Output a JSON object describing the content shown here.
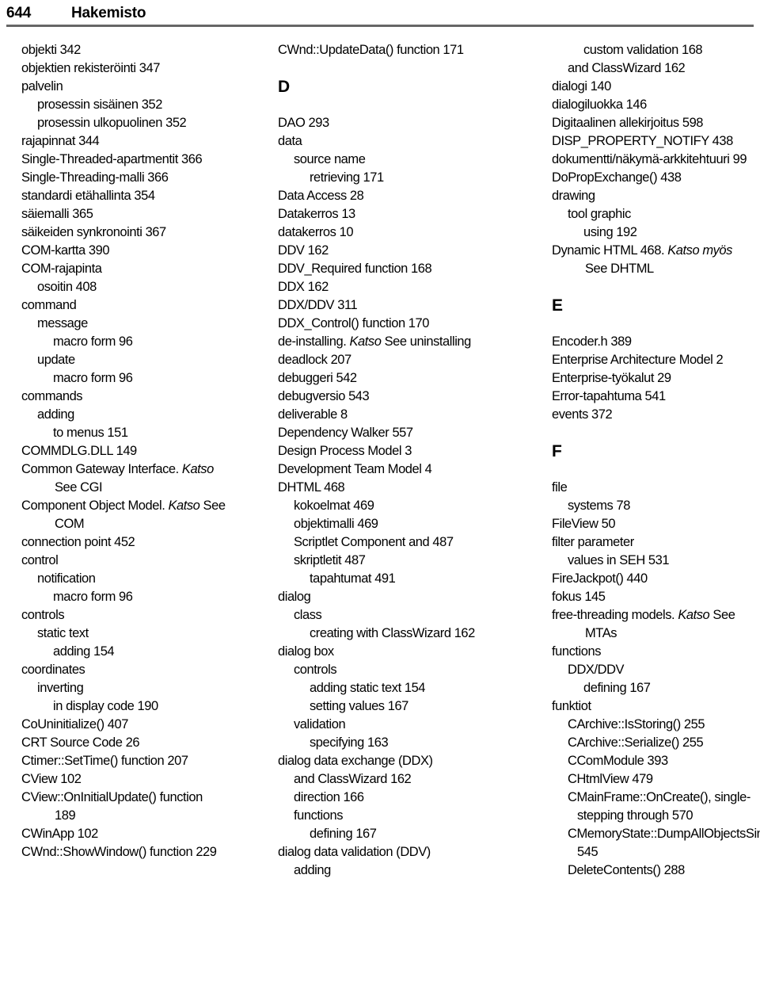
{
  "running_head": {
    "folio": "644",
    "title": "Hakemisto",
    "rule_color": "#666666"
  },
  "columns": [
    {
      "name": "column-1",
      "blocks": [
        {
          "kind": "entry",
          "level": 0,
          "text": "objekti 342"
        },
        {
          "kind": "entry",
          "level": 0,
          "text": "objektien rekisteröinti 347"
        },
        {
          "kind": "entry",
          "level": 0,
          "text": "palvelin"
        },
        {
          "kind": "entry",
          "level": 1,
          "text": "prosessin sisäinen 352"
        },
        {
          "kind": "entry",
          "level": 1,
          "text": "prosessin ulkopuolinen 352"
        },
        {
          "kind": "entry",
          "level": 0,
          "text": "rajapinnat 344"
        },
        {
          "kind": "entry",
          "level": 0,
          "text": "Single-Threaded-apartmentit 366"
        },
        {
          "kind": "entry",
          "level": 0,
          "text": "Single-Threading-malli 366"
        },
        {
          "kind": "entry",
          "level": 0,
          "text": "standardi etähallinta 354"
        },
        {
          "kind": "entry",
          "level": 0,
          "text": "säiemalli 365"
        },
        {
          "kind": "entry",
          "level": 0,
          "text": "säikeiden synkronointi 367"
        },
        {
          "kind": "entry",
          "level": 0,
          "text": "COM-kartta 390"
        },
        {
          "kind": "entry",
          "level": 0,
          "text": "COM-rajapinta"
        },
        {
          "kind": "entry",
          "level": 1,
          "text": "osoitin 408"
        },
        {
          "kind": "entry",
          "level": 0,
          "text": "command"
        },
        {
          "kind": "entry",
          "level": 1,
          "text": "message"
        },
        {
          "kind": "entry",
          "level": 2,
          "text": "macro form 96"
        },
        {
          "kind": "entry",
          "level": 1,
          "text": "update"
        },
        {
          "kind": "entry",
          "level": 2,
          "text": "macro form 96"
        },
        {
          "kind": "entry",
          "level": 0,
          "text": "commands"
        },
        {
          "kind": "entry",
          "level": 1,
          "text": "adding"
        },
        {
          "kind": "entry",
          "level": 2,
          "text": "to menus 151"
        },
        {
          "kind": "entry",
          "level": 0,
          "text": "COMMDLG.DLL 149"
        },
        {
          "kind": "entry-italic",
          "level": 0,
          "pre": "Common Gateway Interface. ",
          "italic": "Katso",
          "post": ""
        },
        {
          "kind": "entry",
          "level": 0,
          "continuation": true,
          "text": "See CGI"
        },
        {
          "kind": "entry-italic",
          "level": 0,
          "pre": "Component Object Model. ",
          "italic": "Katso",
          "post": " See"
        },
        {
          "kind": "entry",
          "level": 0,
          "continuation": true,
          "text": "COM"
        },
        {
          "kind": "entry",
          "level": 0,
          "text": "connection point 452"
        },
        {
          "kind": "entry",
          "level": 0,
          "text": "control"
        },
        {
          "kind": "entry",
          "level": 1,
          "text": "notification"
        },
        {
          "kind": "entry",
          "level": 2,
          "text": "macro form 96"
        },
        {
          "kind": "entry",
          "level": 0,
          "text": "controls"
        },
        {
          "kind": "entry",
          "level": 1,
          "text": "static text"
        },
        {
          "kind": "entry",
          "level": 2,
          "text": "adding 154"
        },
        {
          "kind": "entry",
          "level": 0,
          "text": "coordinates"
        },
        {
          "kind": "entry",
          "level": 1,
          "text": "inverting"
        },
        {
          "kind": "entry",
          "level": 2,
          "text": "in display code 190"
        },
        {
          "kind": "entry",
          "level": 0,
          "text": "CoUninitialize() 407"
        },
        {
          "kind": "entry",
          "level": 0,
          "text": "CRT Source Code 26"
        },
        {
          "kind": "entry",
          "level": 0,
          "text": "Ctimer::SetTime() function 207"
        },
        {
          "kind": "entry",
          "level": 0,
          "text": "CView 102"
        },
        {
          "kind": "entry",
          "level": 0,
          "text": "CView::OnInitialUpdate() function"
        },
        {
          "kind": "entry",
          "level": 0,
          "continuation": true,
          "text": "189"
        },
        {
          "kind": "entry",
          "level": 0,
          "text": "CWinApp 102"
        },
        {
          "kind": "entry",
          "level": 0,
          "text": "CWnd::ShowWindow() function 229"
        }
      ]
    },
    {
      "name": "column-2",
      "blocks": [
        {
          "kind": "entry",
          "level": 0,
          "text": "CWnd::UpdateData() function 171"
        },
        {
          "kind": "spacer"
        },
        {
          "kind": "letter",
          "text": "D"
        },
        {
          "kind": "spacer"
        },
        {
          "kind": "entry",
          "level": 0,
          "text": "DAO 293"
        },
        {
          "kind": "entry",
          "level": 0,
          "text": "data"
        },
        {
          "kind": "entry",
          "level": 1,
          "text": "source name"
        },
        {
          "kind": "entry",
          "level": 2,
          "text": "retrieving 171"
        },
        {
          "kind": "entry",
          "level": 0,
          "text": "Data Access 28"
        },
        {
          "kind": "entry",
          "level": 0,
          "text": "Datakerros 13"
        },
        {
          "kind": "entry",
          "level": 0,
          "text": "datakerros 10"
        },
        {
          "kind": "entry",
          "level": 0,
          "text": "DDV 162"
        },
        {
          "kind": "entry",
          "level": 0,
          "text": "DDV_Required function 168"
        },
        {
          "kind": "entry",
          "level": 0,
          "text": "DDX 162"
        },
        {
          "kind": "entry",
          "level": 0,
          "text": "DDX/DDV 311"
        },
        {
          "kind": "entry",
          "level": 0,
          "text": "DDX_Control() function 170"
        },
        {
          "kind": "entry-italic",
          "level": 0,
          "pre": "de-installing. ",
          "italic": "Katso",
          "post": " See uninstalling"
        },
        {
          "kind": "entry",
          "level": 0,
          "text": "deadlock 207"
        },
        {
          "kind": "entry",
          "level": 0,
          "text": "debuggeri 542"
        },
        {
          "kind": "entry",
          "level": 0,
          "text": "debugversio 543"
        },
        {
          "kind": "entry",
          "level": 0,
          "text": "deliverable 8"
        },
        {
          "kind": "entry",
          "level": 0,
          "text": "Dependency Walker 557"
        },
        {
          "kind": "entry",
          "level": 0,
          "text": "Design Process Model 3"
        },
        {
          "kind": "entry",
          "level": 0,
          "text": "Development Team Model 4"
        },
        {
          "kind": "entry",
          "level": 0,
          "text": "DHTML 468"
        },
        {
          "kind": "entry",
          "level": 1,
          "text": "kokoelmat 469"
        },
        {
          "kind": "entry",
          "level": 1,
          "text": "objektimalli 469"
        },
        {
          "kind": "entry",
          "level": 1,
          "text": "Scriptlet Component and 487"
        },
        {
          "kind": "entry",
          "level": 1,
          "text": "skriptletit 487"
        },
        {
          "kind": "entry",
          "level": 2,
          "text": "tapahtumat 491"
        },
        {
          "kind": "entry",
          "level": 0,
          "text": "dialog"
        },
        {
          "kind": "entry",
          "level": 1,
          "text": "class"
        },
        {
          "kind": "entry",
          "level": 2,
          "text": "creating with ClassWizard 162"
        },
        {
          "kind": "entry",
          "level": 0,
          "text": "dialog box"
        },
        {
          "kind": "entry",
          "level": 1,
          "text": "controls"
        },
        {
          "kind": "entry",
          "level": 2,
          "text": "adding static text 154"
        },
        {
          "kind": "entry",
          "level": 2,
          "text": "setting values 167"
        },
        {
          "kind": "entry",
          "level": 1,
          "text": "validation"
        },
        {
          "kind": "entry",
          "level": 2,
          "text": "specifying 163"
        },
        {
          "kind": "entry",
          "level": 0,
          "text": "dialog data exchange (DDX)"
        },
        {
          "kind": "entry",
          "level": 1,
          "text": "and ClassWizard 162"
        },
        {
          "kind": "entry",
          "level": 1,
          "text": "direction 166"
        },
        {
          "kind": "entry",
          "level": 1,
          "text": "functions"
        },
        {
          "kind": "entry",
          "level": 2,
          "text": "defining 167"
        },
        {
          "kind": "entry",
          "level": 0,
          "text": "dialog data validation (DDV)"
        },
        {
          "kind": "entry",
          "level": 1,
          "text": "adding"
        }
      ]
    },
    {
      "name": "column-3",
      "blocks": [
        {
          "kind": "entry",
          "level": 2,
          "text": "custom validation 168"
        },
        {
          "kind": "entry",
          "level": 1,
          "text": "and ClassWizard 162"
        },
        {
          "kind": "entry",
          "level": 0,
          "text": "dialogi 140"
        },
        {
          "kind": "entry",
          "level": 0,
          "text": "dialogiluokka 146"
        },
        {
          "kind": "entry",
          "level": 0,
          "text": "Digitaalinen allekirjoitus 598"
        },
        {
          "kind": "entry",
          "level": 0,
          "text": "DISP_PROPERTY_NOTIFY 438"
        },
        {
          "kind": "entry",
          "level": 0,
          "text": "dokumentti/näkymä-arkkitehtuuri 99"
        },
        {
          "kind": "entry",
          "level": 0,
          "text": "DoPropExchange() 438"
        },
        {
          "kind": "entry",
          "level": 0,
          "text": "drawing"
        },
        {
          "kind": "entry",
          "level": 1,
          "text": "tool graphic"
        },
        {
          "kind": "entry",
          "level": 2,
          "text": "using 192"
        },
        {
          "kind": "entry-italic",
          "level": 0,
          "pre": "Dynamic HTML 468. ",
          "italic": "Katso myös",
          "post": ""
        },
        {
          "kind": "entry",
          "level": 0,
          "continuation": true,
          "text": "See DHTML"
        },
        {
          "kind": "spacer"
        },
        {
          "kind": "letter",
          "text": "E"
        },
        {
          "kind": "spacer"
        },
        {
          "kind": "entry",
          "level": 0,
          "text": "Encoder.h 389"
        },
        {
          "kind": "entry",
          "level": 0,
          "text": "Enterprise Architecture Model 2"
        },
        {
          "kind": "entry",
          "level": 0,
          "text": "Enterprise-työkalut 29"
        },
        {
          "kind": "entry",
          "level": 0,
          "text": "Error-tapahtuma 541"
        },
        {
          "kind": "entry",
          "level": 0,
          "text": "events 372"
        },
        {
          "kind": "spacer"
        },
        {
          "kind": "letter",
          "text": "F"
        },
        {
          "kind": "spacer"
        },
        {
          "kind": "entry",
          "level": 0,
          "text": "file"
        },
        {
          "kind": "entry",
          "level": 1,
          "text": "systems 78"
        },
        {
          "kind": "entry",
          "level": 0,
          "text": "FileView 50"
        },
        {
          "kind": "entry",
          "level": 0,
          "text": "filter parameter"
        },
        {
          "kind": "entry",
          "level": 1,
          "text": "values in SEH 531"
        },
        {
          "kind": "entry",
          "level": 0,
          "text": "FireJackpot() 440"
        },
        {
          "kind": "entry",
          "level": 0,
          "text": "fokus 145"
        },
        {
          "kind": "entry-italic",
          "level": 0,
          "pre": "free-threading models. ",
          "italic": "Katso",
          "post": " See"
        },
        {
          "kind": "entry",
          "level": 0,
          "continuation": true,
          "text": "MTAs"
        },
        {
          "kind": "entry",
          "level": 0,
          "text": "functions"
        },
        {
          "kind": "entry",
          "level": 1,
          "text": "DDX/DDV"
        },
        {
          "kind": "entry",
          "level": 2,
          "text": "defining 167"
        },
        {
          "kind": "entry",
          "level": 0,
          "text": "funktiot"
        },
        {
          "kind": "entry",
          "level": 1,
          "text": "CArchive::IsStoring() 255"
        },
        {
          "kind": "entry",
          "level": 1,
          "text": "CArchive::Serialize() 255"
        },
        {
          "kind": "entry",
          "level": 1,
          "text": "CComModule 393"
        },
        {
          "kind": "entry",
          "level": 1,
          "text": "CHtmlView 479"
        },
        {
          "kind": "entry",
          "level": 1,
          "text": "CMainFrame::OnCreate(), single-"
        },
        {
          "kind": "entry",
          "level": 1,
          "continuation": true,
          "text": "stepping through 570"
        },
        {
          "kind": "entry",
          "level": 1,
          "text": "CMemoryState::DumpAllObjectsSince()"
        },
        {
          "kind": "entry",
          "level": 1,
          "continuation": true,
          "text": "545"
        },
        {
          "kind": "entry",
          "level": 1,
          "text": "DeleteContents() 288"
        }
      ]
    }
  ]
}
